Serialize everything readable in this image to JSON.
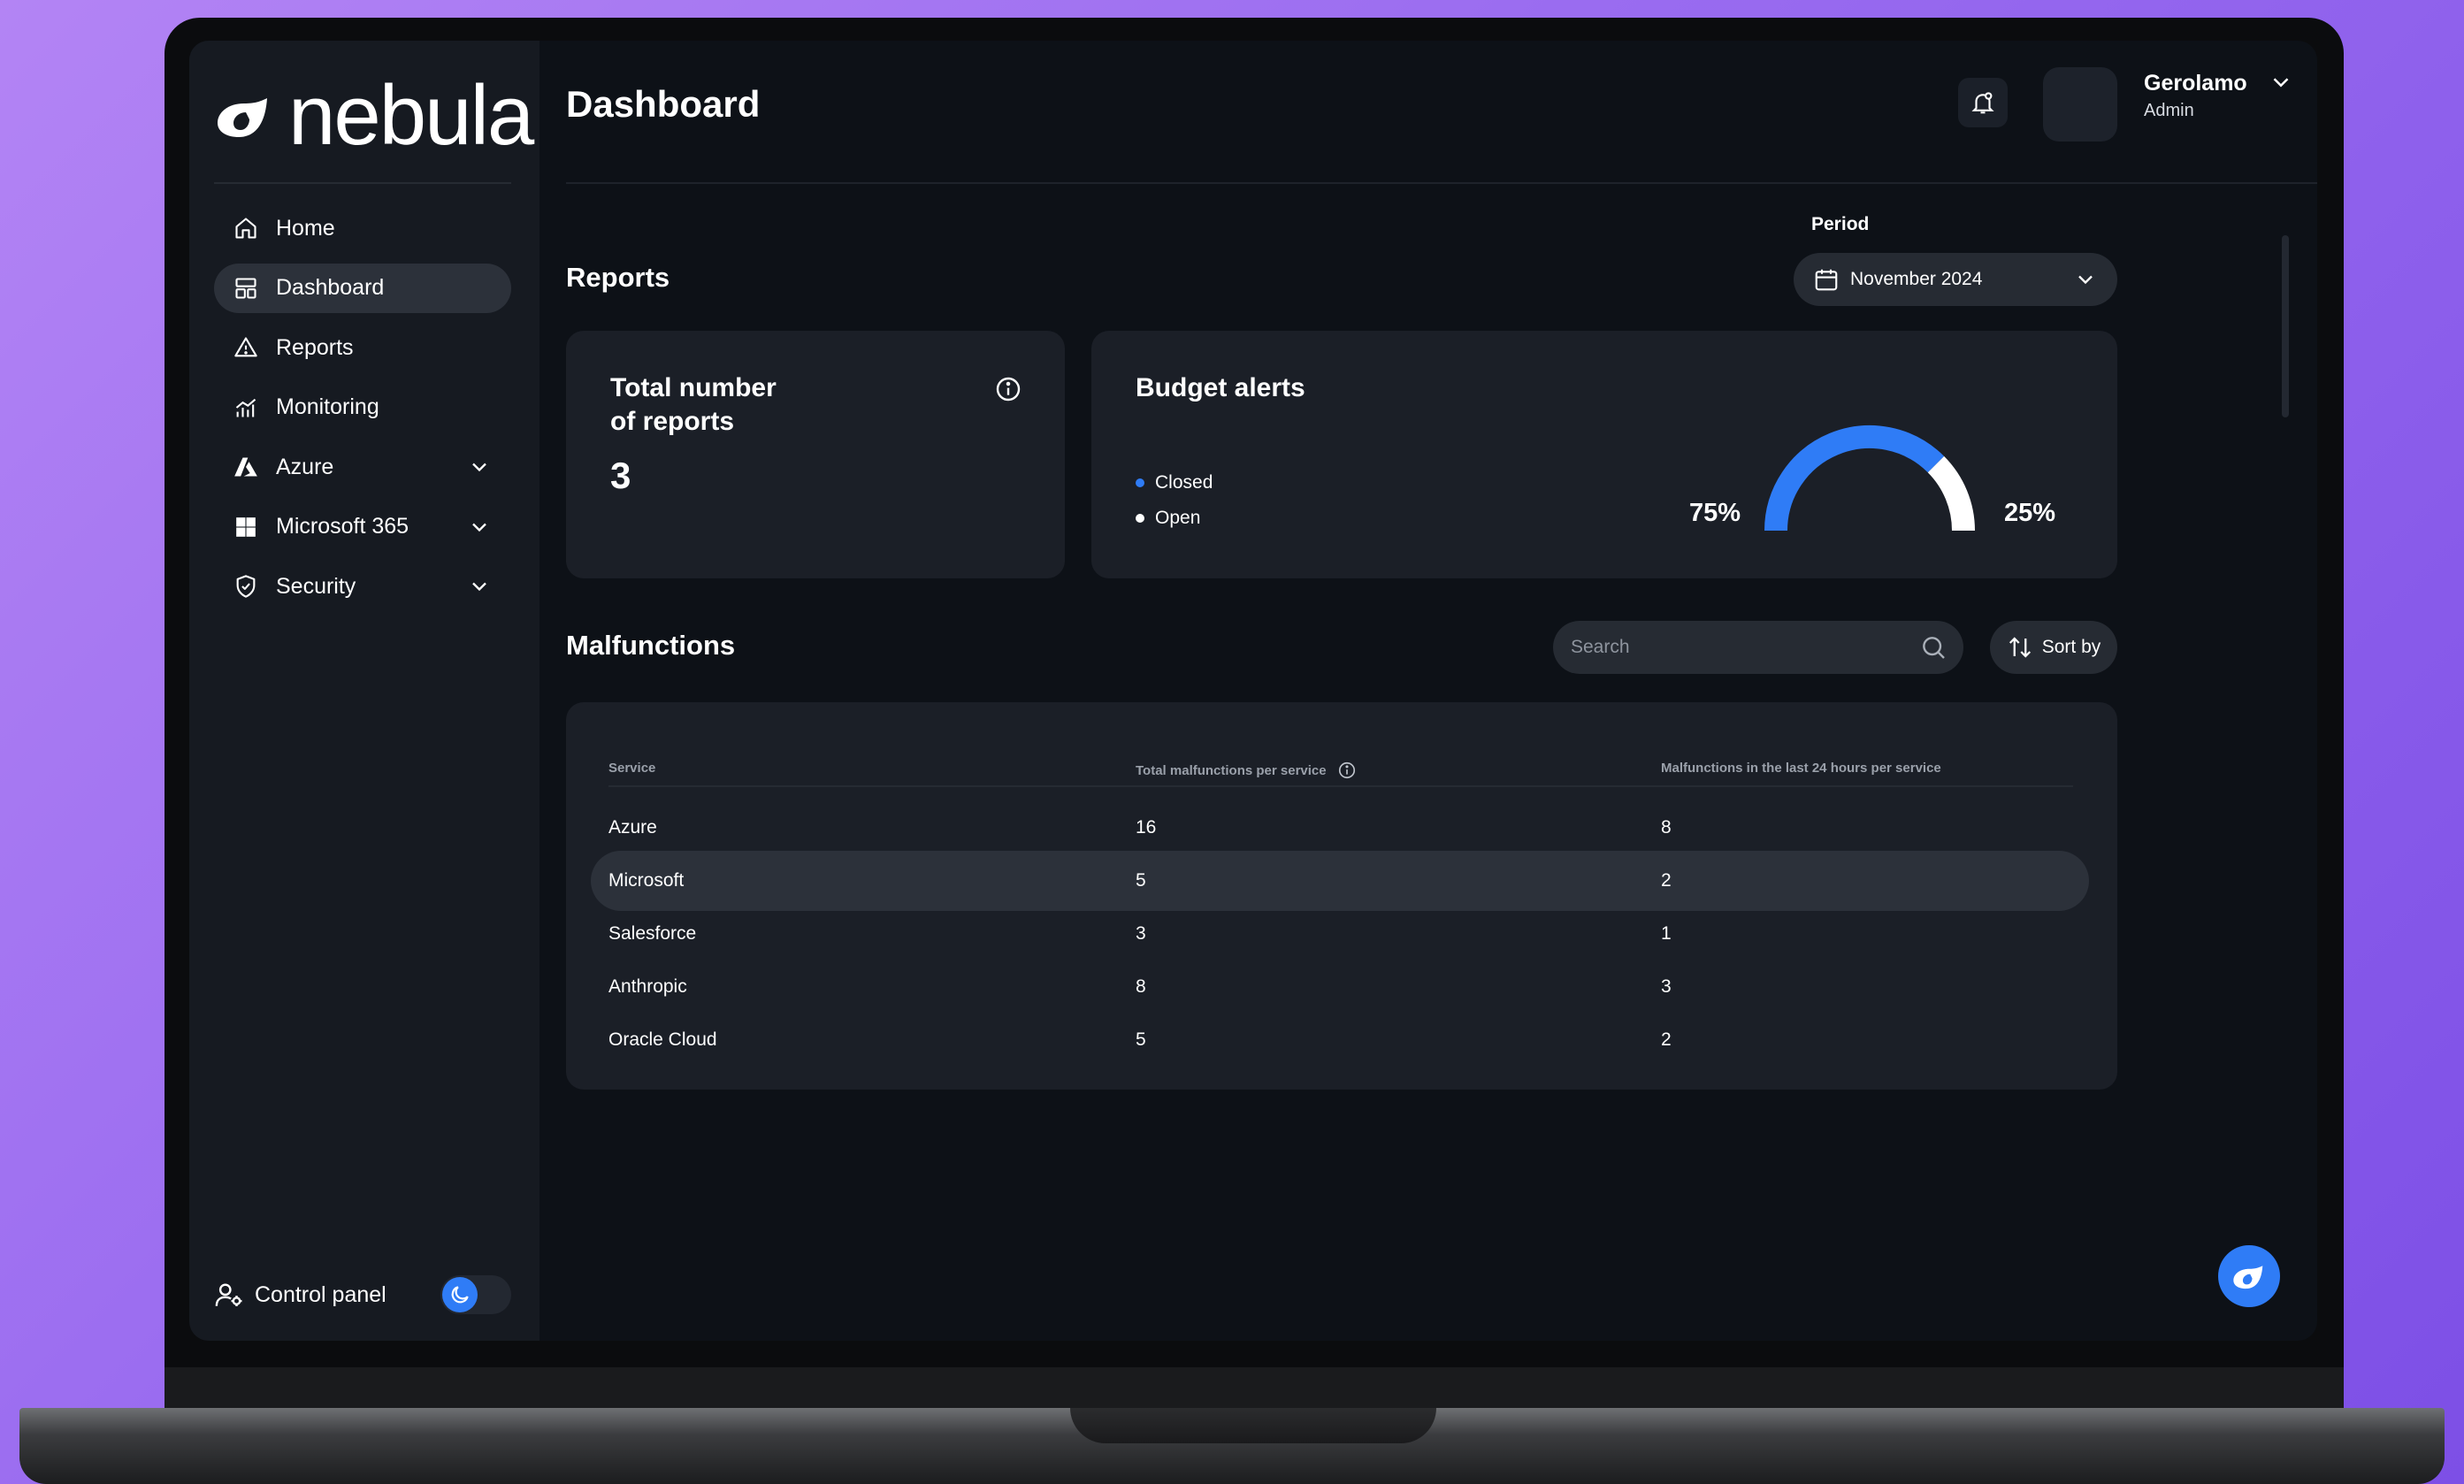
{
  "brand": {
    "name": "nebula"
  },
  "sidebar": {
    "items": [
      {
        "label": "Home",
        "icon": "home-icon"
      },
      {
        "label": "Dashboard",
        "icon": "layout-icon",
        "active": true
      },
      {
        "label": "Reports",
        "icon": "warning-icon"
      },
      {
        "label": "Monitoring",
        "icon": "chart-icon"
      },
      {
        "label": "Azure",
        "icon": "azure-icon",
        "expandable": true
      },
      {
        "label": "Microsoft 365",
        "icon": "windows-icon",
        "expandable": true
      },
      {
        "label": "Security",
        "icon": "shield-icon",
        "expandable": true
      }
    ],
    "footer": {
      "label": "Control panel",
      "icon": "user-gear-icon"
    }
  },
  "header": {
    "title": "Dashboard",
    "user": {
      "name": "Gerolamo",
      "role": "Admin"
    }
  },
  "reports": {
    "title": "Reports",
    "period": {
      "label": "Period",
      "value": "November 2024"
    },
    "total_card": {
      "title_line1": "Total number",
      "title_line2": "of reports",
      "value": "3"
    },
    "budget_card": {
      "title": "Budget alerts",
      "legend": [
        {
          "label": "Closed",
          "color": "#2f7cf6"
        },
        {
          "label": "Open",
          "color": "#ffffff"
        }
      ],
      "closed_pct_label": "75%",
      "open_pct_label": "25%",
      "closed_fraction": 0.75
    }
  },
  "malfunctions": {
    "title": "Malfunctions",
    "search_placeholder": "Search",
    "sort_label": "Sort by",
    "columns": [
      "Service",
      "Total malfunctions per service",
      "Malfunctions in the last 24 hours per service"
    ],
    "rows": [
      {
        "service": "Azure",
        "total": "16",
        "last24": "8"
      },
      {
        "service": "Microsoft",
        "total": "5",
        "last24": "2",
        "highlight": true
      },
      {
        "service": "Salesforce",
        "total": "3",
        "last24": "1"
      },
      {
        "service": "Anthropic",
        "total": "8",
        "last24": "3"
      },
      {
        "service": "Oracle Cloud",
        "total": "5",
        "last24": "2"
      }
    ]
  },
  "colors": {
    "accent": "#2f7cf6",
    "background": "#0d1117",
    "surface": "#1b1f27"
  }
}
